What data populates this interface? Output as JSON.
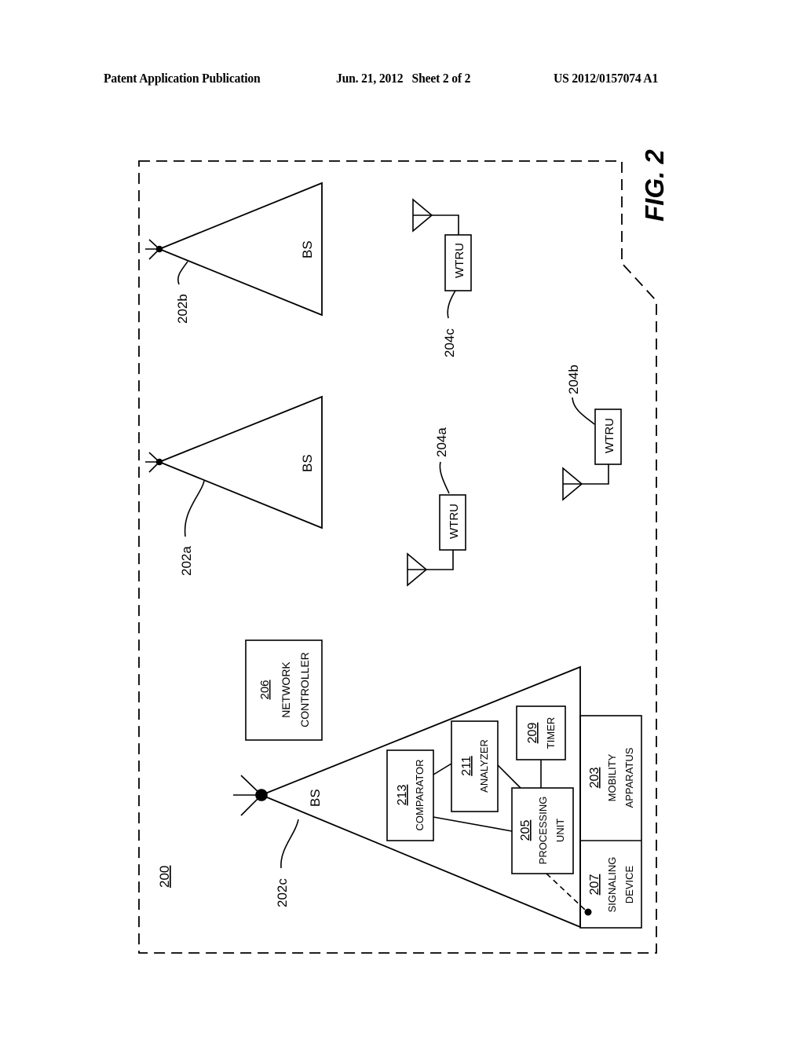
{
  "header": {
    "publication": "Patent Application Publication",
    "date_sheet": "Jun. 21, 2012   Sheet 2 of 2",
    "number": "US 2012/0157074 A1"
  },
  "figure": {
    "title": "FIG. 2",
    "system_ref": "200",
    "base_stations": [
      {
        "ref": "202a",
        "label": "BS"
      },
      {
        "ref": "202b",
        "label": "BS"
      },
      {
        "ref": "202c",
        "label": "BS"
      }
    ],
    "wtrus": [
      {
        "ref": "204a",
        "label": "WTRU"
      },
      {
        "ref": "204b",
        "label": "WTRU"
      },
      {
        "ref": "204c",
        "label": "WTRU"
      }
    ],
    "network_controller": {
      "ref": "206",
      "line1": "NETWORK",
      "line2": "CONTROLLER"
    },
    "components": {
      "comparator": {
        "ref": "213",
        "line1": "COMPARATOR"
      },
      "analyzer": {
        "ref": "211",
        "line1": "ANALYZER"
      },
      "timer": {
        "ref": "209",
        "line1": "TIMER"
      },
      "processing_unit": {
        "ref": "205",
        "line1": "PROCESSING",
        "line2": "UNIT"
      },
      "mobility_apparatus": {
        "ref": "203",
        "line1": "MOBILITY",
        "line2": "APPARATUS"
      },
      "signaling_device": {
        "ref": "207",
        "line1": "SIGNALING",
        "line2": "DEVICE"
      }
    }
  }
}
